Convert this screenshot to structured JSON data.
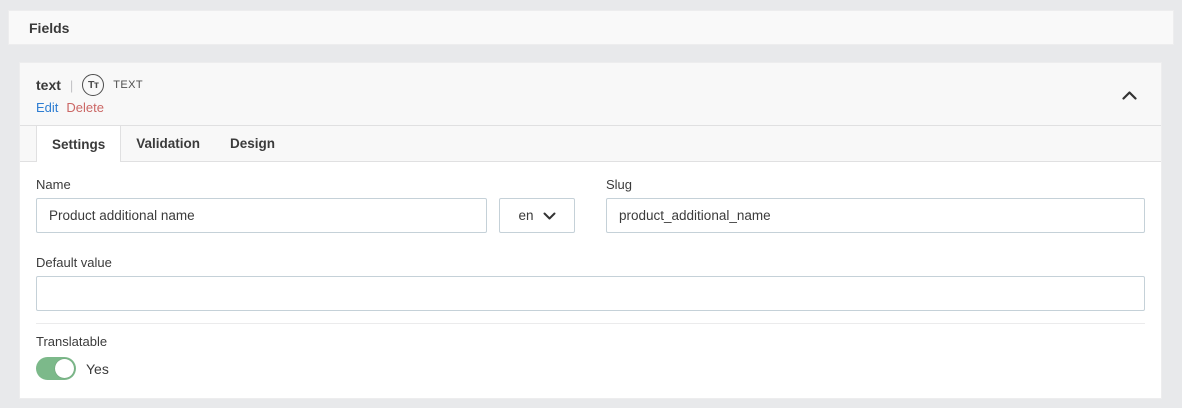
{
  "page": {
    "title": "Fields"
  },
  "field_card": {
    "name": "text",
    "separator": "|",
    "type_icon_text": "Tᴛ",
    "type_label": "TEXT",
    "actions": {
      "edit": "Edit",
      "delete": "Delete"
    },
    "collapse_icon": "chevron-up-icon",
    "tabs": [
      {
        "label": "Settings",
        "active": true
      },
      {
        "label": "Validation",
        "active": false
      },
      {
        "label": "Design",
        "active": false
      }
    ],
    "settings": {
      "name_field": {
        "label": "Name",
        "value": "Product additional name"
      },
      "language_select": {
        "value": "en",
        "icon": "chevron-down-icon"
      },
      "slug_field": {
        "label": "Slug",
        "value": "product_additional_name"
      },
      "default_value_field": {
        "label": "Default value",
        "value": ""
      },
      "translatable": {
        "label": "Translatable",
        "state": "Yes",
        "enabled": true
      }
    }
  },
  "colors": {
    "toggle_on": "#7cb98a",
    "edit_link": "#2d7dd2",
    "delete_link": "#cb6765",
    "page_background": "#e8e9eb"
  }
}
